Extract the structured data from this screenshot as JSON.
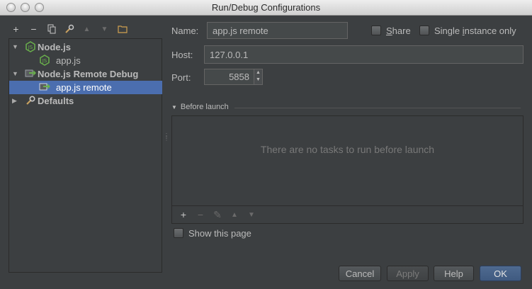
{
  "window": {
    "title": "Run/Debug Configurations"
  },
  "toolbar": {
    "buttons": [
      {
        "icon": "plus-icon",
        "glyph": "+"
      },
      {
        "icon": "minus-icon",
        "glyph": "−"
      },
      {
        "icon": "copy-icon",
        "glyph": "⎘"
      },
      {
        "icon": "wrench-icon",
        "glyph": "⚒"
      },
      {
        "icon": "arrow-up-icon",
        "glyph": "▲"
      },
      {
        "icon": "arrow-down-icon",
        "glyph": "▼"
      },
      {
        "icon": "folder-icon",
        "glyph": "▭"
      }
    ]
  },
  "tree": {
    "items": [
      {
        "label": "Node.js",
        "bold": true,
        "expanded": true,
        "icon": "nodejs-icon"
      },
      {
        "label": "app.js",
        "bold": false,
        "icon": "nodejs-icon"
      },
      {
        "label": "Node.js Remote Debug",
        "bold": true,
        "expanded": true,
        "icon": "remote-debug-icon"
      },
      {
        "label": "app.js remote",
        "bold": false,
        "selected": true,
        "icon": "remote-debug-icon"
      },
      {
        "label": "Defaults",
        "bold": true,
        "expanded": false,
        "icon": "wrench-icon"
      }
    ]
  },
  "form": {
    "name_label": "Name:",
    "name_value": "app.js remote",
    "share_label_u": "S",
    "share_label_rest": "hare",
    "single_instance_label_pre": "Single ",
    "single_instance_label_u": "i",
    "single_instance_label_post": "nstance only",
    "host_label": "Host:",
    "host_value": "127.0.0.1",
    "port_label": "Port:",
    "port_value": "5858"
  },
  "before_launch": {
    "title": "Before launch",
    "empty_text": "There are no tasks to run before launch",
    "toolbar": [
      {
        "icon": "plus-icon",
        "glyph": "+",
        "enabled": true
      },
      {
        "icon": "minus-icon",
        "glyph": "−",
        "enabled": false
      },
      {
        "icon": "pencil-icon",
        "glyph": "✎",
        "enabled": false
      },
      {
        "icon": "arrow-up-icon",
        "glyph": "▲",
        "enabled": false
      },
      {
        "icon": "arrow-down-icon",
        "glyph": "▼",
        "enabled": false
      }
    ],
    "show_page_label": "Show this page"
  },
  "buttons": {
    "cancel": "Cancel",
    "apply": "Apply",
    "help": "Help",
    "ok": "OK"
  },
  "colors": {
    "background": "#3c3f41",
    "selection": "#4b6eaf",
    "nodejs_green": "#6ab04c"
  }
}
